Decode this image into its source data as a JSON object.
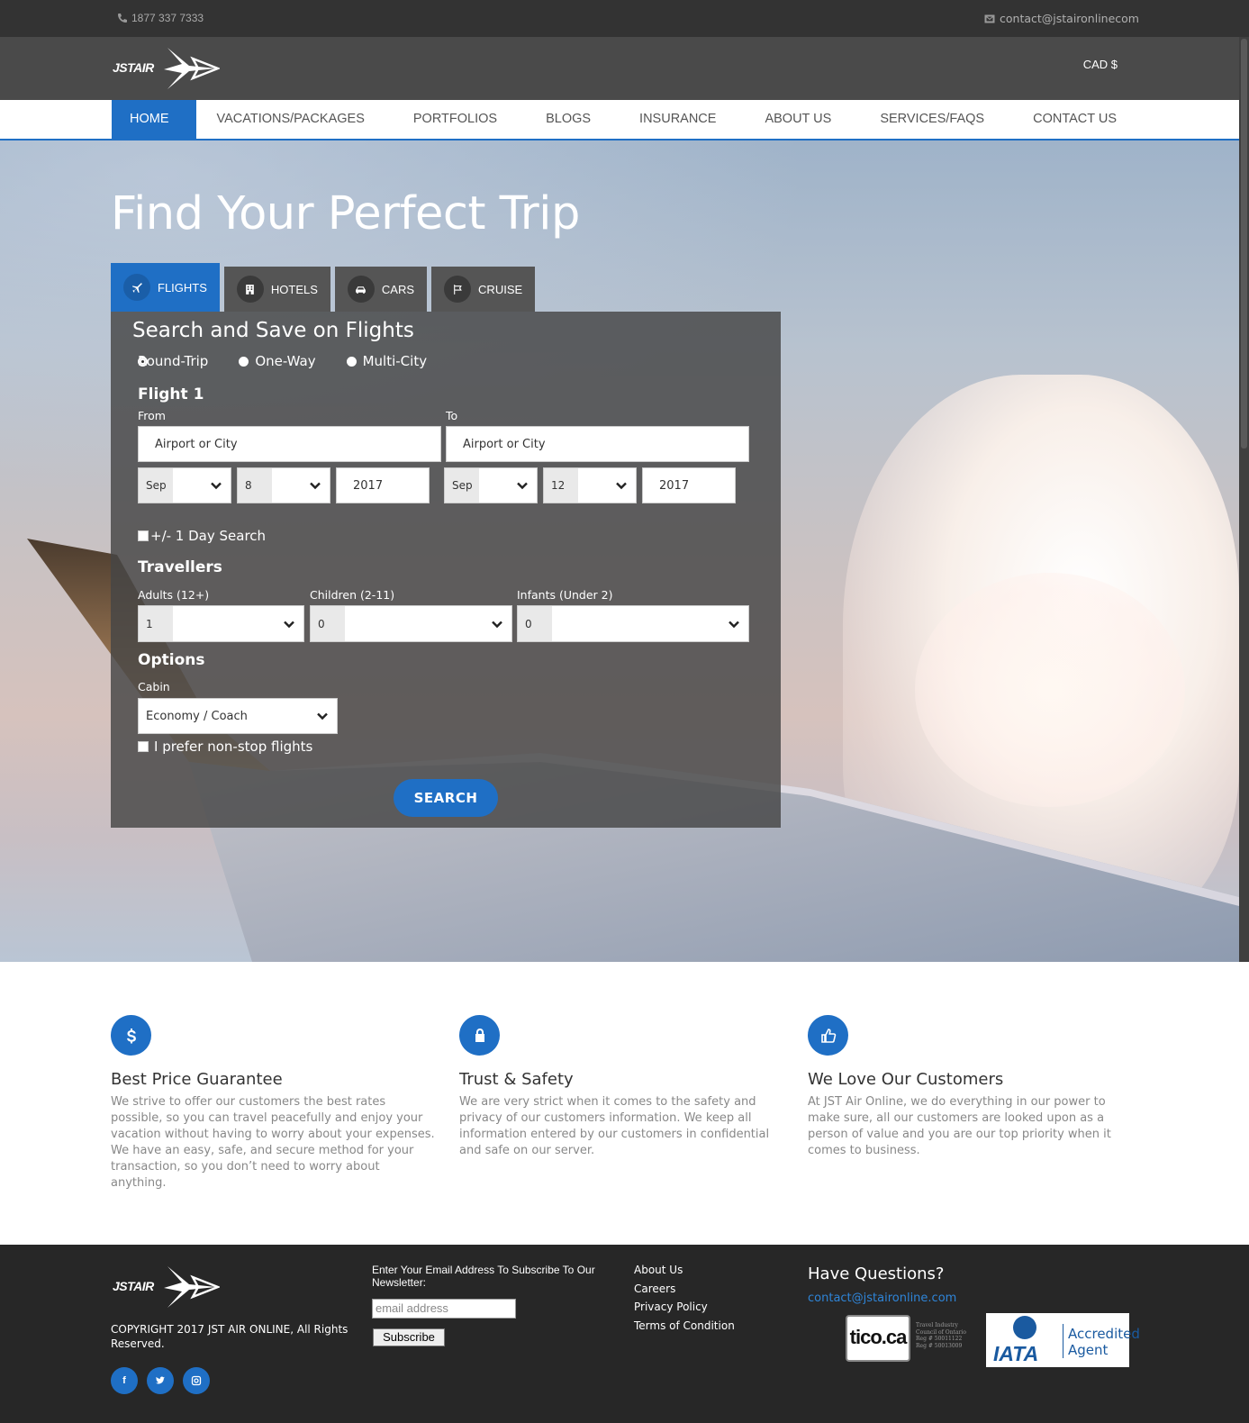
{
  "topbar": {
    "phone": "1877 337 7333",
    "email": "contact@jstaironlinecom"
  },
  "header": {
    "logo_text": "JSTAIR",
    "currency": "CAD $"
  },
  "nav": {
    "items": [
      {
        "label": "HOME",
        "active": true
      },
      {
        "label": "VACATIONS/PACKAGES"
      },
      {
        "label": "PORTFOLIOS"
      },
      {
        "label": "BLOGS"
      },
      {
        "label": "INSURANCE"
      },
      {
        "label": "ABOUT US"
      },
      {
        "label": "SERVICES/FAQS"
      },
      {
        "label": "CONTACT US"
      }
    ]
  },
  "hero": {
    "title": "Find Your Perfect Trip",
    "tabs": [
      {
        "label": "FLIGHTS",
        "icon": "plane-icon",
        "active": true
      },
      {
        "label": "HOTELS",
        "icon": "building-icon"
      },
      {
        "label": "CARS",
        "icon": "car-icon"
      },
      {
        "label": "CRUISE",
        "icon": "flag-icon"
      }
    ]
  },
  "search": {
    "title": "Search and Save on Flights",
    "trip_types": [
      "Round-Trip",
      "One-Way",
      "Multi-City"
    ],
    "selected_trip_type": "Round-Trip",
    "flight_label": "Flight 1",
    "from_label": "From",
    "to_label": "To",
    "from_placeholder": "Airport or City",
    "to_placeholder": "Airport or City",
    "depart": {
      "month": "Sep",
      "day": "8",
      "year": "2017"
    },
    "return": {
      "month": "Sep",
      "day": "12",
      "year": "2017"
    },
    "flex_day_label": "+/- 1 Day Search",
    "travellers_label": "Travellers",
    "adults_label": "Adults (12+)",
    "adults_value": "1",
    "children_label": "Children (2-11)",
    "children_value": "0",
    "infants_label": "Infants (Under 2)",
    "infants_value": "0",
    "options_label": "Options",
    "cabin_label": "Cabin",
    "cabin_value": "Economy / Coach",
    "nonstop_label": "I prefer non-stop flights",
    "search_button": "SEARCH"
  },
  "features": [
    {
      "icon": "dollar-icon",
      "title": "Best Price Guarantee",
      "text": "We strive to offer our customers the best rates possible, so you can travel peacefully and enjoy your vacation without having to worry about your expenses. We have an easy, safe, and secure method for your transaction, so you don’t need to worry about anything."
    },
    {
      "icon": "lock-icon",
      "title": "Trust & Safety",
      "text": "We are very strict when it comes to the safety and privacy of our customers information. We keep all information entered by our customers in confidential and safe on our server."
    },
    {
      "icon": "thumbs-up-icon",
      "title": "We Love Our Customers",
      "text": "At JST Air Online, we do everything in our power to make sure, all our customers are looked upon as a person of value and you are our top priority when it comes to business."
    }
  ],
  "footer": {
    "copyright": "COPYRIGHT 2017 JST AIR ONLINE, All Rights Reserved.",
    "social": [
      "facebook-icon",
      "twitter-icon",
      "instagram-icon"
    ],
    "newsletter_label": "Enter Your Email Address To Subscribe To Our Newsletter:",
    "newsletter_placeholder": "email address",
    "subscribe_button": "Subscribe",
    "links": [
      "About Us",
      "Careers",
      "Privacy Policy",
      "Terms of Condition"
    ],
    "questions_title": "Have Questions?",
    "contact_email": "contact@jstaironline.com",
    "tico_badge": "tico.ca",
    "tico_note": "Travel Industry Council of Ontario Reg # 50011122 Reg # 50013009",
    "iata_text": "IATA",
    "iata_accredited": "Accredited",
    "iata_agent": "Agent"
  },
  "colors": {
    "brand_blue": "#1f6fc5",
    "topbar": "#333333",
    "logobar": "#4a4a4a",
    "footer": "#272727"
  }
}
